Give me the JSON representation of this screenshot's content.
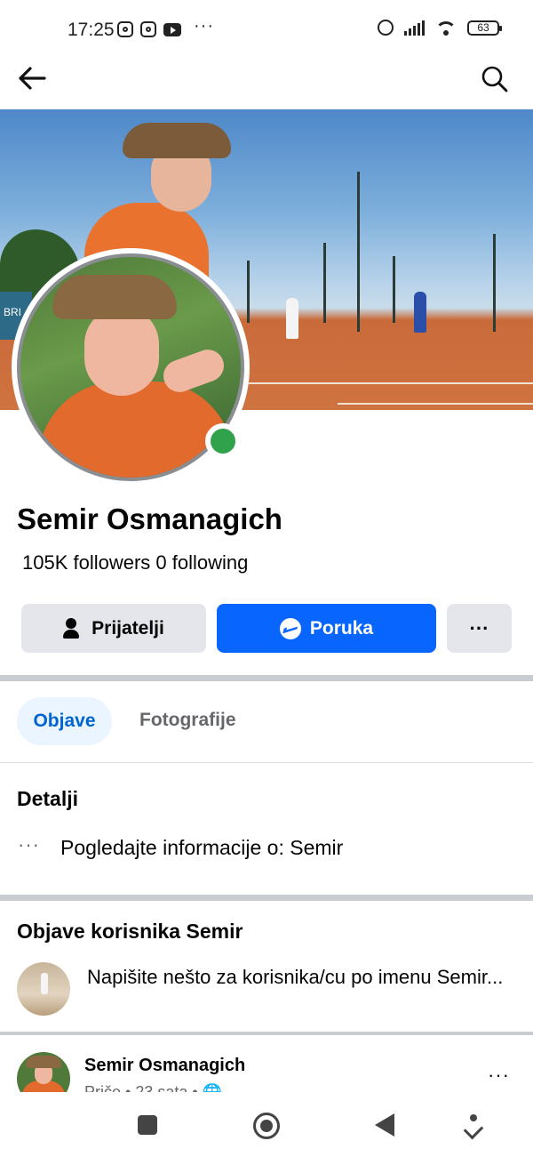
{
  "status_bar": {
    "time": "17:25",
    "battery": "63"
  },
  "profile": {
    "name": "Semir Osmanagich",
    "followers_line": "105K followers 0 following",
    "online": true
  },
  "actions": {
    "friends_label": "Prijatelji",
    "message_label": "Poruka",
    "more_label": "···"
  },
  "tabs": [
    {
      "label": "Objave",
      "active": true
    },
    {
      "label": "Fotografije",
      "active": false
    }
  ],
  "details": {
    "title": "Detalji",
    "row_text": "Pogledajte informacije o: Semir",
    "row_dots": "···"
  },
  "posts_section": {
    "title": "Objave korisnika Semir",
    "composer_placeholder": "Napišite nešto za korisnika/cu po imenu Semir..."
  },
  "first_post": {
    "author": "Semir Osmanagich",
    "meta": "Priče • 23 sata • 🌐",
    "more_label": "···"
  },
  "colors": {
    "accent": "#0866ff",
    "tab_active_bg": "#ebf5ff",
    "tab_active_text": "#0064d1",
    "online": "#31a24c",
    "secondary_button": "#e4e6eb"
  },
  "icons": {
    "back": "arrow-left",
    "search": "magnifier",
    "friends": "person-check",
    "message": "messenger",
    "more": "ellipsis"
  }
}
